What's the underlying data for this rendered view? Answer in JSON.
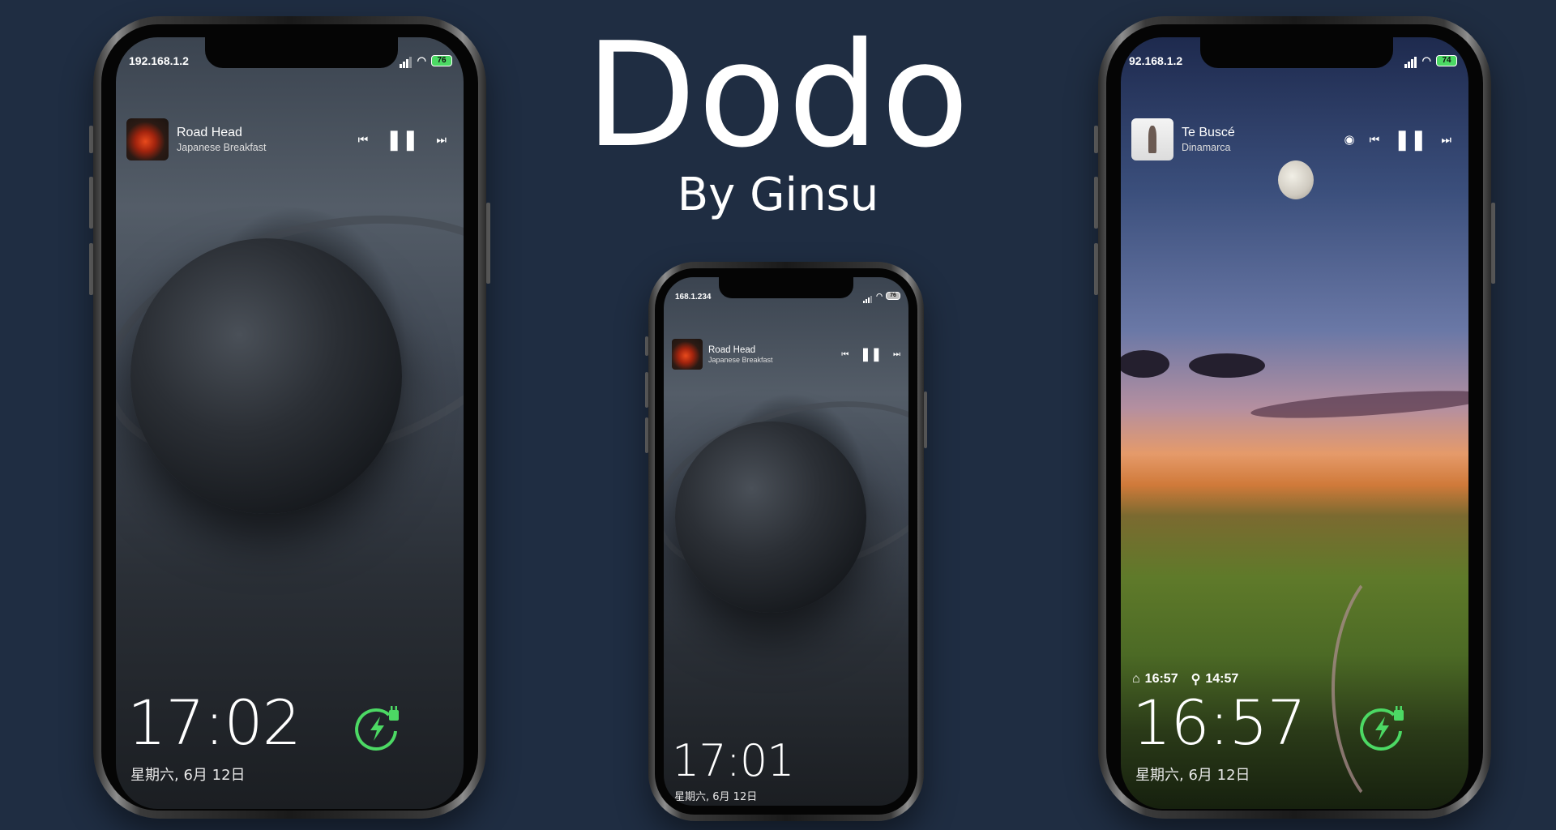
{
  "header": {
    "title": "Dodo",
    "subtitle": "By Ginsu"
  },
  "accent_colors": {
    "background": "#1f2d42",
    "charge_green": "#4cd964",
    "battery_fill": "#4cd964"
  },
  "phones": [
    {
      "status": {
        "ip": "192.168.1.2",
        "battery": "76"
      },
      "media": {
        "title": "Road Head",
        "artist": "Japanese Breakfast",
        "art": "album-art-fire"
      },
      "clock": "17:02",
      "date": "星期六, 6月 12日",
      "charging_icon": "charging-bolt-plug-icon"
    },
    {
      "status": {
        "ip": "168.1.234",
        "battery": "76"
      },
      "media": {
        "title": "Road Head",
        "artist": "Japanese Breakfast",
        "art": "album-art-fire"
      },
      "clock": "17:01",
      "date": "星期六, 6月 12日"
    },
    {
      "status": {
        "ip": "92.168.1.2",
        "battery": "74"
      },
      "media": {
        "title": "Te Buscé",
        "artist": "Dinamarca",
        "art": "album-art-te-busce"
      },
      "weather": {
        "home_time": "16:57",
        "location_time": "14:57"
      },
      "clock": "16:57",
      "date": "星期六, 6月 12日",
      "charging_icon": "charging-bolt-plug-icon"
    }
  ]
}
